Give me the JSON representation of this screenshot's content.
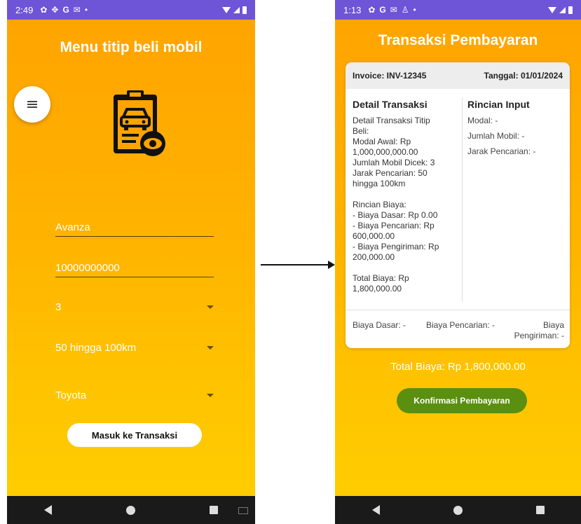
{
  "left_screen": {
    "status": {
      "time": "2:49"
    },
    "title": "Menu titip beli mobil",
    "inputs": {
      "model": "Avanza",
      "budget": "10000000000"
    },
    "dropdowns": {
      "car_count": "3",
      "distance": "50 hingga 100km",
      "brand": "Toyota"
    },
    "submit_label": "Masuk ke Transaksi"
  },
  "right_screen": {
    "status": {
      "time": "1:13"
    },
    "title": "Transaksi Pembayaran",
    "invoice_label": "Invoice: INV-12345",
    "date_label": "Tanggal: 01/01/2024",
    "detail_title": "Detail Transaksi",
    "detail_text": "Detail Transaksi Titip\nBeli:\nModal Awal: Rp\n1,000,000,000.00\nJumlah Mobil Dicek: 3\nJarak Pencarian: 50\nhingga 100km\n\nRincian Biaya:\n- Biaya Dasar: Rp 0.00\n- Biaya Pencarian: Rp\n600,000.00\n- Biaya Pengiriman: Rp\n200,000.00\n\nTotal Biaya: Rp\n1,800,000.00",
    "rincian_title": "Rincian Input",
    "rincian": {
      "modal": "Modal: -",
      "jumlah": "Jumlah Mobil: -",
      "jarak": "Jarak Pencarian: -"
    },
    "footer": {
      "basic": "Biaya Dasar: -",
      "search": "Biaya Pencarian: -",
      "shipping": "Biaya\nPengiriman: -"
    },
    "total_text": "Total Biaya: Rp 1,800,000.00",
    "confirm_label": "Konfirmasi Pembayaran"
  },
  "icons": [
    "settings-icon",
    "pinwheel-icon",
    "google-icon",
    "mail-icon",
    "wifi-icon",
    "signal-icon",
    "battery-icon",
    "menu-icon",
    "car-clipboard-icon",
    "back-icon",
    "home-icon",
    "recent-apps-icon"
  ],
  "colors": {
    "gradient_top": "#ffa300",
    "gradient_bottom": "#ffcf00",
    "status_bar": "#6e54d6",
    "confirm_button": "#5b8f10",
    "nav_bar": "#1a1a1a"
  }
}
